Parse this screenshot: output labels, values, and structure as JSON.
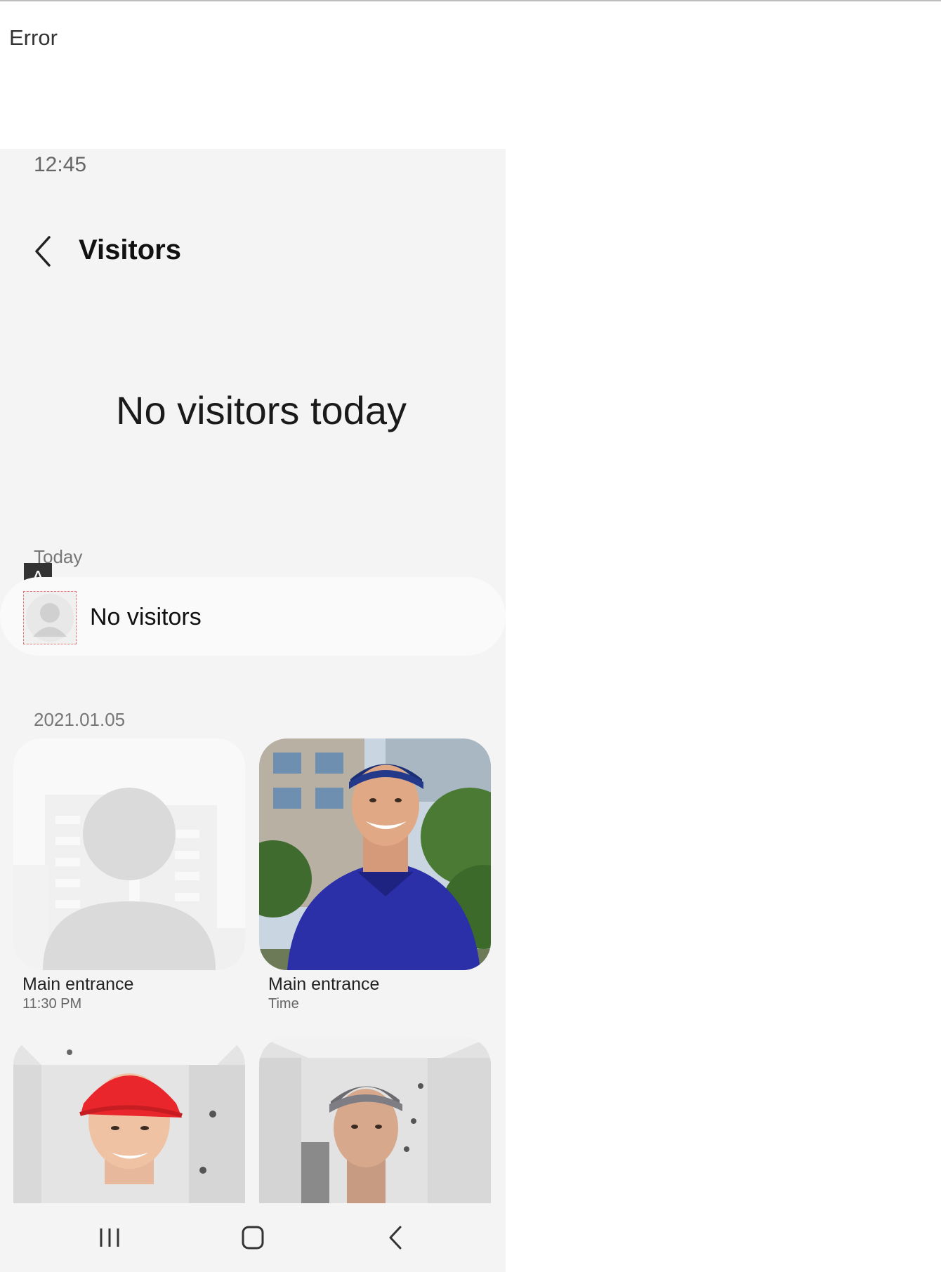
{
  "window": {
    "title": "Error"
  },
  "status_bar": {
    "time": "12:45"
  },
  "header": {
    "title": "Visitors",
    "back_icon": "chevron-left-icon"
  },
  "empty_state": {
    "message": "No visitors today"
  },
  "today": {
    "label": "Today",
    "badge": "A",
    "card": {
      "text": "No visitors",
      "avatar_icon": "person-placeholder-icon"
    }
  },
  "history": {
    "date": "2021.01.05",
    "items": [
      {
        "location": "Main entrance",
        "time": "11:30 PM",
        "image": "placeholder-person"
      },
      {
        "location": "Main entrance",
        "time": "Time",
        "image": "delivery-man-photo"
      },
      {
        "location": "",
        "time": "",
        "image": "woman-red-cap-photo"
      },
      {
        "location": "",
        "time": "",
        "image": "man-grey-cap-photo"
      }
    ]
  },
  "navbar": {
    "recent_icon": "recent-apps-icon",
    "home_icon": "home-icon",
    "back_icon": "back-icon"
  }
}
